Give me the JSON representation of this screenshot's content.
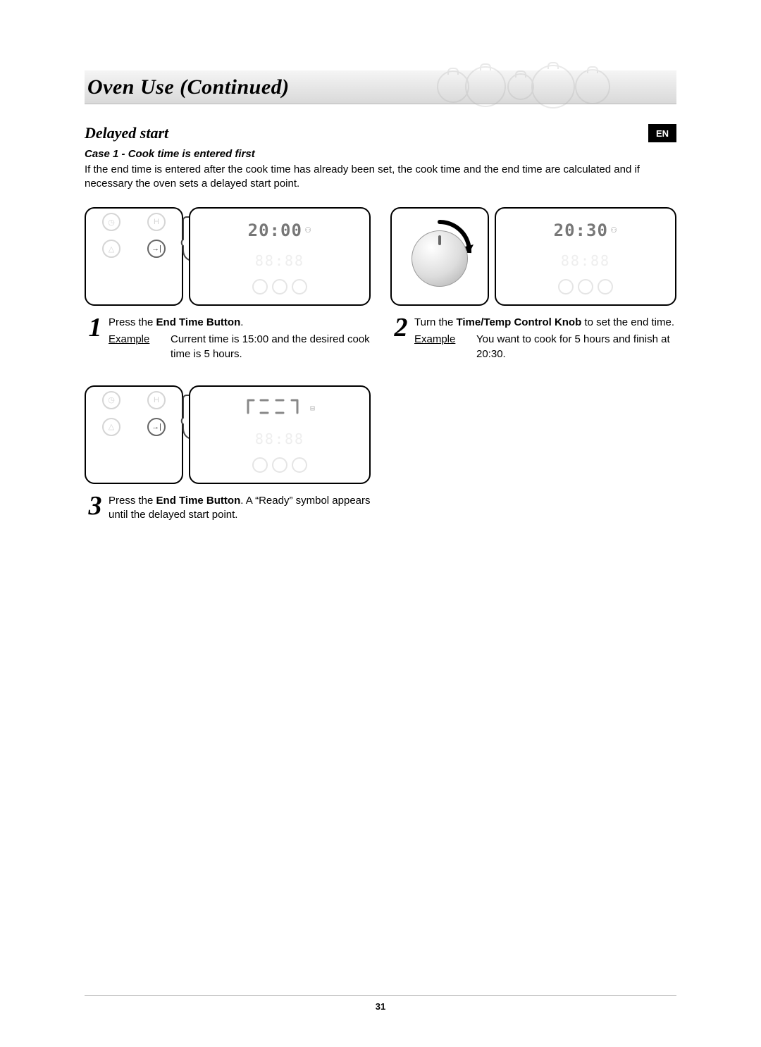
{
  "banner_title": "Oven Use (Continued)",
  "lang_badge": "EN",
  "section_title": "Delayed start",
  "case_heading": "Case 1 - Cook time is entered first",
  "intro_text": "If the end time is entered after the cook time has already been set, the cook time and the end time are calculated and if necessary the oven sets a delayed start point.",
  "steps": {
    "s1": {
      "num": "1",
      "display_time": "20:00",
      "ghost": "88:88",
      "ready_display": "",
      "text_pre": "Press the ",
      "control": "End Time Button",
      "text_post": ".",
      "example_label": "Example",
      "example_body": "Current time is 15:00 and the desired cook time is 5 hours."
    },
    "s2": {
      "num": "2",
      "display_time": "20:30",
      "ghost": "88:88",
      "text_pre": "Turn the ",
      "control": "Time/Temp Control Knob",
      "text_post": " to set the end time.",
      "example_label": "Example",
      "example_body": "You want to cook for 5 hours and finish at 20:30."
    },
    "s3": {
      "num": "3",
      "ready_display": "[ ‾ ‾ ]",
      "ghost": "88:88",
      "text_pre": "Press the ",
      "control": "End Time Button",
      "text_post": ". A “Ready” symbol appears until the delayed start point."
    }
  },
  "page_number": "31"
}
